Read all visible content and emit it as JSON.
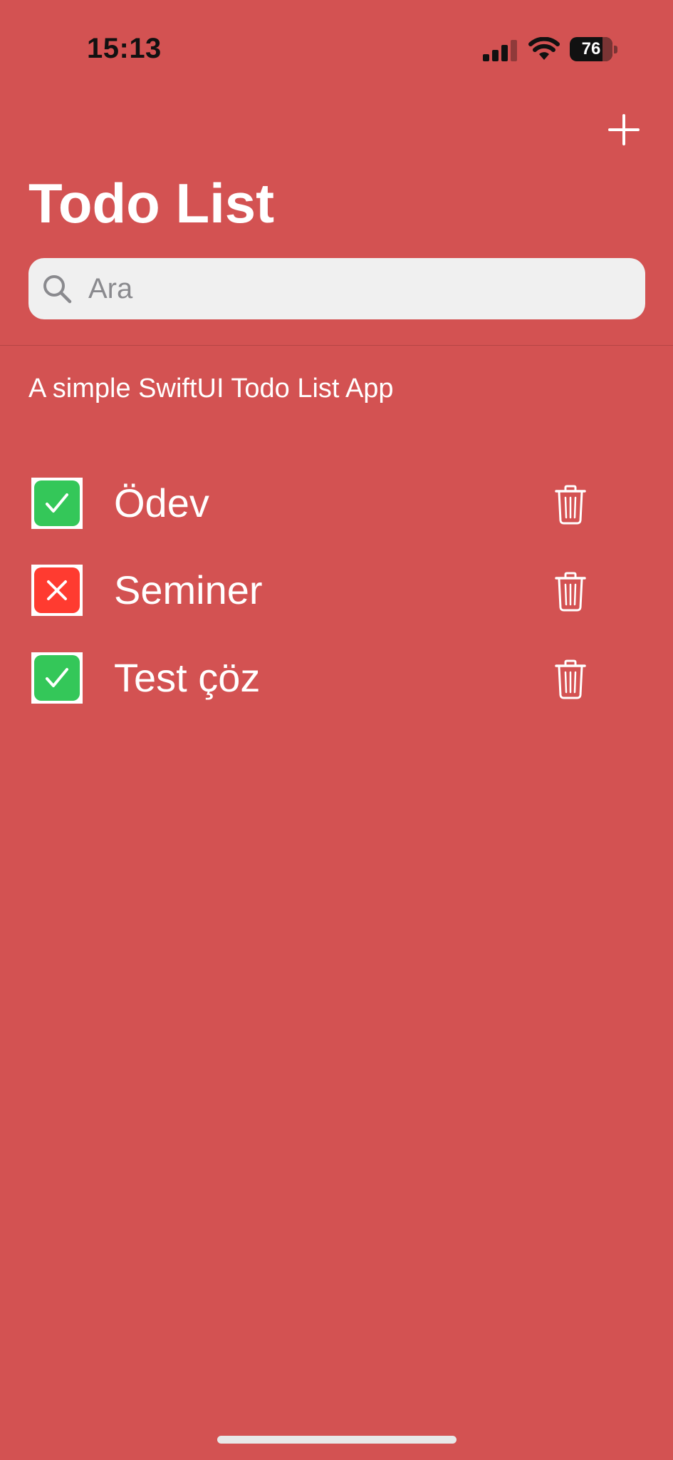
{
  "status_bar": {
    "time": "15:13",
    "battery_level": "76",
    "signal_icon": "cellular-signal-icon",
    "wifi_icon": "wifi-icon"
  },
  "nav": {
    "add_icon": "plus-icon"
  },
  "page": {
    "title": "Todo List",
    "subtitle": "A simple SwiftUI Todo List App",
    "background_color": "#D35252"
  },
  "search": {
    "placeholder": "Ara",
    "value": "",
    "icon": "magnifying-glass-icon"
  },
  "todos": [
    {
      "title": "Ödev",
      "completed": true,
      "status_icon": "checkmark-icon",
      "status_color": "#34C759",
      "delete_icon": "trash-icon"
    },
    {
      "title": "Seminer",
      "completed": false,
      "status_icon": "xmark-icon",
      "status_color": "#FF3B30",
      "delete_icon": "trash-icon"
    },
    {
      "title": "Test çöz",
      "completed": true,
      "status_icon": "checkmark-icon",
      "status_color": "#34C759",
      "delete_icon": "trash-icon"
    }
  ]
}
